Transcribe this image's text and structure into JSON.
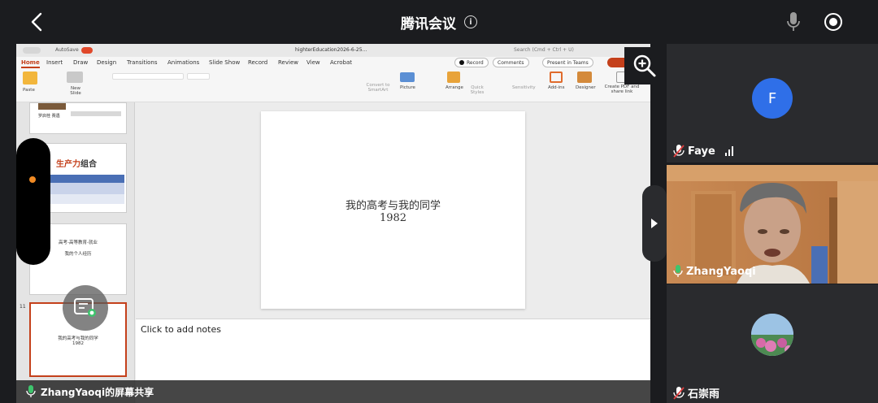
{
  "meeting": {
    "title": "腾讯会议",
    "info_icon": "i"
  },
  "powerpoint": {
    "titlebar": {
      "autosave_label": "AutoSave",
      "filename": "highterEducation2026-6-25...",
      "search_placeholder": "Search (Cmd + Ctrl + U)"
    },
    "tabs": [
      "Home",
      "Insert",
      "Draw",
      "Design",
      "Transitions",
      "Animations",
      "Slide Show",
      "Record",
      "Review",
      "View",
      "Acrobat"
    ],
    "active_tab": "Home",
    "actions": {
      "record": "Record",
      "comments": "Comments",
      "present_in_teams": "Present in Teams"
    },
    "ribbon": {
      "paste": "Paste",
      "new_slide": "New Slide",
      "convert_smartart": "Convert to SmartArt",
      "picture": "Picture",
      "arrange": "Arrange",
      "quick_styles": "Quick Styles",
      "sensitivity": "Sensitivity",
      "add_ins": "Add-ins",
      "designer": "Designer",
      "create_pdf": "Create PDF and share link"
    },
    "thumbnails": {
      "slide_a_caption": "罗启桂 赛遇",
      "slide_b_title_red": "生产力",
      "slide_b_title_rest": "组合",
      "slide_c_line1": "高考-高等教育-就业",
      "slide_c_line2": "我的个人经历",
      "slide_11_number": "11",
      "slide_11_line1": "我的高考与我的同学",
      "slide_11_line2": "1982"
    },
    "slide": {
      "title": "我的高考与我的同学",
      "subtitle": "1982"
    },
    "notes_placeholder": "Click to add notes"
  },
  "share_status": "ZhangYaoqi的屏幕共享",
  "participants": [
    {
      "name": "Faye",
      "avatar_letter": "F",
      "avatar_color": "#2f6fe8"
    },
    {
      "name": "ZhangYaoqi"
    },
    {
      "name": "石崇雨"
    }
  ],
  "colors": {
    "accent_orange": "#f08a24",
    "ppt_red": "#c4401b",
    "mic_muted_red": "#e04040",
    "mic_green": "#3ec46d"
  }
}
